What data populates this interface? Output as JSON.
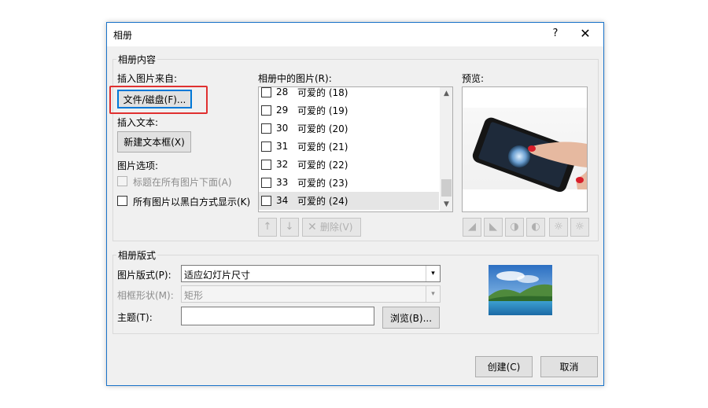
{
  "dialog": {
    "title": "相册",
    "help_icon": "?",
    "close_icon": "✕"
  },
  "content_group": {
    "legend": "相册内容",
    "insert_from_label": "插入图片来自:",
    "file_disk_button": "文件/磁盘(F)...",
    "insert_text_label": "插入文本:",
    "new_textbox_button": "新建文本框(X)",
    "picture_options_label": "图片选项:",
    "caption_below_label": "标题在所有图片下面(A)",
    "caption_below_checked": false,
    "caption_below_enabled": false,
    "all_bw_label": "所有图片以黑白方式显示(K)",
    "all_bw_checked": false
  },
  "picture_list": {
    "label": "相册中的图片(R):",
    "items": [
      {
        "num": "28",
        "name": "可爱的 (18)",
        "checked": false,
        "selected": false
      },
      {
        "num": "29",
        "name": "可爱的 (19)",
        "checked": false,
        "selected": false
      },
      {
        "num": "30",
        "name": "可爱的 (20)",
        "checked": false,
        "selected": false
      },
      {
        "num": "31",
        "name": "可爱的 (21)",
        "checked": false,
        "selected": false
      },
      {
        "num": "32",
        "name": "可爱的 (22)",
        "checked": false,
        "selected": false
      },
      {
        "num": "33",
        "name": "可爱的 (23)",
        "checked": false,
        "selected": false
      },
      {
        "num": "34",
        "name": "可爱的 (24)",
        "checked": false,
        "selected": true
      }
    ],
    "move_up_icon": "arrow-up-icon",
    "move_down_icon": "arrow-down-icon",
    "delete_button": "删除(V)"
  },
  "preview": {
    "label": "预览:",
    "tools": [
      "rotate-left-icon",
      "rotate-right-icon",
      "contrast-up-icon",
      "contrast-down-icon",
      "brightness-up-icon",
      "brightness-down-icon"
    ]
  },
  "layout_group": {
    "legend": "相册版式",
    "picture_layout_label": "图片版式(P):",
    "picture_layout_value": "适应幻灯片尺寸",
    "frame_shape_label": "相框形状(M):",
    "frame_shape_value": "矩形",
    "theme_label": "主题(T):",
    "theme_value": "",
    "browse_button": "浏览(B)..."
  },
  "footer": {
    "create_button": "创建(C)",
    "cancel_button": "取消"
  },
  "colors": {
    "highlight": "#e03030",
    "accent": "#0078d7"
  }
}
